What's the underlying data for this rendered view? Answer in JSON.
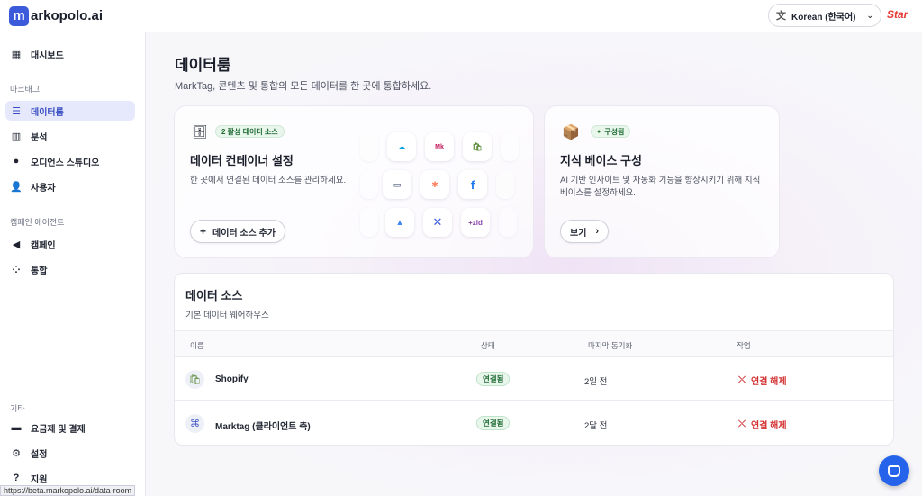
{
  "header": {
    "logo_letter": "m",
    "logo_text": "arkopolo.ai",
    "language": "Korean (한국어)",
    "right_logo": "Star"
  },
  "sidebar": {
    "dashboard": "대시보드",
    "section_marktag": "마크태그",
    "items_marktag": [
      "데이터룸",
      "분석",
      "오디언스 스튜디오",
      "사용자"
    ],
    "section_campaign": "캠페인 에이전트",
    "items_campaign": [
      "캠페인",
      "통합"
    ],
    "section_other": "기타",
    "items_other": [
      "요금제 및 결제",
      "설정",
      "지원"
    ]
  },
  "status_url": "https://beta.markopolo.ai/data-room",
  "page": {
    "title": "데이터룸",
    "subtitle": "MarkTag, 콘텐츠 및 통합의 모든 데이터를 한 곳에 통합하세요."
  },
  "card_container": {
    "badge": "2 활성 데이터 소스",
    "title": "데이터 컨테이너 설정",
    "description": "한 곳에서 연결된 데이터 소스를 관리하세요.",
    "button": "데이터 소스 추가",
    "logos": [
      "Salesforce",
      "Mailchimp",
      "Shopify",
      "Inbox",
      "HubSpot",
      "Facebook",
      "Google Ads",
      "Make",
      "zid"
    ]
  },
  "card_knowledge": {
    "badge": "구성됨",
    "title": "지식 베이스 구성",
    "description": "AI 기반 인사이트 및 자동화 기능을 향상시키기 위해 지식 베이스를 설정하세요.",
    "button": "보기"
  },
  "data_sources": {
    "title": "데이터 소스",
    "subtitle": "기본 데이터 웨어하우스",
    "columns": [
      "이름",
      "상태",
      "마지막 동기화",
      "작업"
    ],
    "rows": [
      {
        "name": "Shopify",
        "status": "연결됨",
        "last_sync": "2일 전",
        "action": "연결 해제"
      },
      {
        "name": "Marktag (클라이언트 측)",
        "status": "연결됨",
        "last_sync": "2달 전",
        "action": "연결 해제"
      }
    ]
  },
  "colors": {
    "accent": "#3b5bdb",
    "danger": "#d32f2f",
    "success": "#1f6b34"
  }
}
